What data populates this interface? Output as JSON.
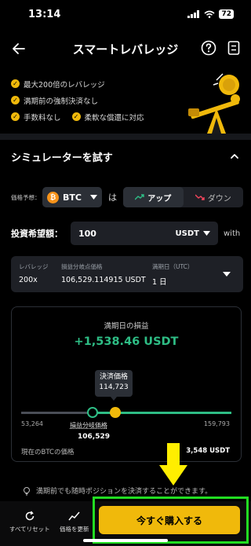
{
  "status": {
    "time": "13:14",
    "battery": "72"
  },
  "header": {
    "title": "スマートレバレッジ"
  },
  "features": {
    "max_leverage": "最大200倍のレバレッジ",
    "no_liquidation": "満期前の強制決済なし",
    "no_fee": "手数料なし",
    "flexible": "柔軟な償還に対応"
  },
  "simulator": {
    "title": "シミュレーターを試す",
    "prediction_label": "価格予想：",
    "coin": "BTC",
    "particle": "は",
    "up_label": "アップ",
    "down_label": "ダウン",
    "amount_label": "投資希望額：",
    "amount_value": "100",
    "currency": "USDT",
    "with": "with"
  },
  "info": {
    "leverage_label": "レバレッジ",
    "leverage_value": "200x",
    "breakeven_label": "損益分岐点価格",
    "breakeven_value": "106,529.114915 USDT",
    "expiry_label": "満期日（UTC）",
    "expiry_value": "1 日"
  },
  "pnl": {
    "label": "満期日の損益",
    "value": "+1,538.46 USDT",
    "settle_label": "決済価格",
    "settle_value": "114,723",
    "scale_min": "53,264",
    "scale_max": "159,793",
    "be_label": "損益分岐価格",
    "be_value": "106,529",
    "current_label": "現在のBTCの価格",
    "current_value": "3,548 USDT"
  },
  "notice": "満期前でも随時ポジションを決済することができます。",
  "bottom": {
    "reset": "すべてリセット",
    "update_price": "価格を更新",
    "buy": "今すぐ購入する"
  },
  "colors": {
    "accent": "#f0b90b",
    "profit": "#2ebd85",
    "loss": "#f6465d",
    "highlight": "#22dd22"
  }
}
